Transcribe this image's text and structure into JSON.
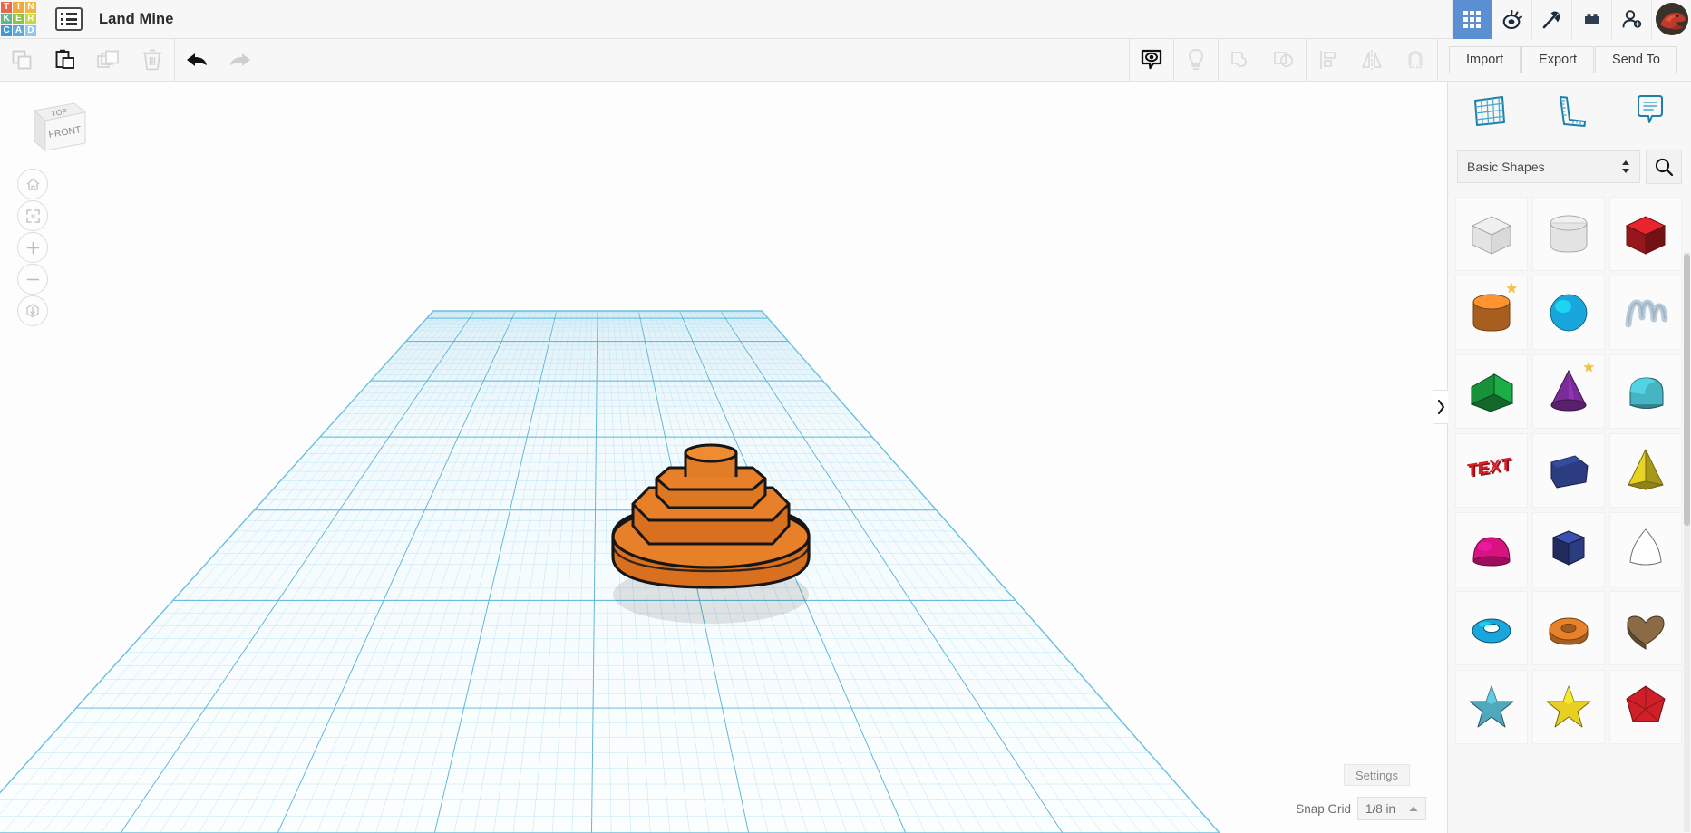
{
  "app": {
    "logo_letters": [
      {
        "ch": "T",
        "color": "#e8694a"
      },
      {
        "ch": "I",
        "color": "#f0a73c"
      },
      {
        "ch": "N",
        "color": "#f2b73d"
      },
      {
        "ch": "K",
        "color": "#5fb88d"
      },
      {
        "ch": "E",
        "color": "#8cc640"
      },
      {
        "ch": "R",
        "color": "#c3d93f"
      },
      {
        "ch": "C",
        "color": "#3f9bd6"
      },
      {
        "ch": "A",
        "color": "#5aa9e0"
      },
      {
        "ch": "D",
        "color": "#8fc8e8"
      }
    ],
    "project_title": "Land Mine",
    "doclist_icon": "list-view-icon"
  },
  "topbar_right": {
    "buttons": [
      {
        "name": "dashboard-grid-button",
        "icon": "grid-9-icon",
        "active": true
      },
      {
        "name": "codeblocks-button",
        "icon": "codeblocks-icon",
        "active": false
      },
      {
        "name": "minecraft-button",
        "icon": "pickaxe-icon",
        "active": false
      },
      {
        "name": "blocks-button",
        "icon": "lego-brick-icon",
        "active": false
      },
      {
        "name": "invite-button",
        "icon": "add-person-icon",
        "active": false
      }
    ],
    "avatar_name": "user-avatar"
  },
  "toolbar": {
    "left_tools": [
      {
        "name": "copy-button",
        "icon": "copy-icon",
        "enabled": false
      },
      {
        "name": "paste-button",
        "icon": "clipboard-paste-icon",
        "enabled": true
      },
      {
        "name": "duplicate-button",
        "icon": "duplicate-icon",
        "enabled": false
      },
      {
        "name": "delete-button",
        "icon": "trash-icon",
        "enabled": false
      }
    ],
    "history_tools": [
      {
        "name": "undo-button",
        "icon": "undo-arrow-icon",
        "enabled": true
      },
      {
        "name": "redo-button",
        "icon": "redo-arrow-icon",
        "enabled": false
      }
    ],
    "right_tools": [
      {
        "name": "show-hide-button",
        "icon": "eye-bubble-icon",
        "enabled": true
      },
      {
        "name": "light-button",
        "icon": "lightbulb-icon",
        "enabled": false
      },
      {
        "name": "group-button",
        "icon": "group-shapes-icon",
        "enabled": false
      },
      {
        "name": "ungroup-button",
        "icon": "ungroup-shapes-icon",
        "enabled": false
      },
      {
        "name": "align-button",
        "icon": "align-icon",
        "enabled": false
      },
      {
        "name": "mirror-button",
        "icon": "mirror-flip-icon",
        "enabled": false
      },
      {
        "name": "snap-magnet-button",
        "icon": "magnet-icon",
        "enabled": false
      }
    ],
    "import_label": "Import",
    "export_label": "Export",
    "sendto_label": "Send To"
  },
  "canvas": {
    "viewcube": {
      "top_label": "TOP",
      "front_label": "FRONT"
    },
    "nav_buttons": [
      {
        "name": "home-view-button",
        "icon": "home-icon"
      },
      {
        "name": "fit-view-button",
        "icon": "fit-brackets-icon"
      },
      {
        "name": "zoom-in-button",
        "icon": "plus-icon"
      },
      {
        "name": "zoom-out-button",
        "icon": "minus-icon"
      },
      {
        "name": "ortho-perspective-button",
        "icon": "cube-arrow-icon"
      }
    ],
    "model": {
      "name": "land-mine-model",
      "color": "#e8802a",
      "edge_color": "#1a1a1a"
    },
    "grid": {
      "minor_color": "#bfe3f2",
      "major_color": "#5bb3d4",
      "plane_fill": "#f4fbfe"
    }
  },
  "right_panel": {
    "tabs": [
      {
        "name": "tab-workplane",
        "icon": "workplane-grid-icon"
      },
      {
        "name": "tab-ruler",
        "icon": "ruler-icon"
      },
      {
        "name": "tab-notes",
        "icon": "note-bubble-icon"
      }
    ],
    "category_label": "Basic Shapes",
    "search_icon": "search-icon",
    "collapse_icon": "chevron-right-icon",
    "shapes": [
      {
        "name": "shape-box-hole",
        "label": "Box Hole",
        "kind": "box",
        "color": "#d8d8d8",
        "hole": true,
        "star": false
      },
      {
        "name": "shape-cylinder-hole",
        "label": "Cylinder Hole",
        "kind": "cylinder",
        "color": "#d8d8d8",
        "hole": true,
        "star": false
      },
      {
        "name": "shape-box",
        "label": "Box",
        "kind": "box",
        "color": "#cf2027",
        "hole": false,
        "star": false
      },
      {
        "name": "shape-cylinder",
        "label": "Cylinder",
        "kind": "cylinder",
        "color": "#e8822a",
        "hole": false,
        "star": true
      },
      {
        "name": "shape-sphere",
        "label": "Sphere",
        "kind": "sphere",
        "color": "#18a6dd",
        "hole": false,
        "star": false
      },
      {
        "name": "shape-scribble",
        "label": "Scribble",
        "kind": "scribble",
        "color": "#b7cbdb",
        "hole": false,
        "star": false
      },
      {
        "name": "shape-wedge",
        "label": "Wedge",
        "kind": "wedge",
        "color": "#17913a",
        "hole": false,
        "star": false
      },
      {
        "name": "shape-cone",
        "label": "Cone",
        "kind": "cone",
        "color": "#7a2d98",
        "hole": false,
        "star": true
      },
      {
        "name": "shape-roof",
        "label": "Roof",
        "kind": "roof",
        "color": "#46b4c2",
        "hole": false,
        "star": false
      },
      {
        "name": "shape-text",
        "label": "Text",
        "kind": "text",
        "color": "#d81f26",
        "hole": false,
        "star": false
      },
      {
        "name": "shape-polygon-prism",
        "label": "Polygon",
        "kind": "polyprism",
        "color": "#2c3c80",
        "hole": false,
        "star": false
      },
      {
        "name": "shape-pyramid",
        "label": "Pyramid",
        "kind": "pyramid",
        "color": "#e8d226",
        "hole": false,
        "star": false
      },
      {
        "name": "shape-half-sphere",
        "label": "Half Sphere",
        "kind": "dome",
        "color": "#d6137f",
        "hole": false,
        "star": false
      },
      {
        "name": "shape-hexagon-prism",
        "label": "Hexagon",
        "kind": "hexprism",
        "color": "#2c3c80",
        "hole": false,
        "star": false
      },
      {
        "name": "shape-paraboloid",
        "label": "Paraboloid",
        "kind": "parab",
        "color": "#e4e4e4",
        "hole": false,
        "star": false
      },
      {
        "name": "shape-torus",
        "label": "Torus",
        "kind": "torus",
        "color": "#18a6dd",
        "hole": false,
        "star": false
      },
      {
        "name": "shape-tube",
        "label": "Tube",
        "kind": "tube",
        "color": "#e8822a",
        "hole": false,
        "star": false
      },
      {
        "name": "shape-heart",
        "label": "Heart",
        "kind": "heart",
        "color": "#8a6b45",
        "hole": false,
        "star": false
      },
      {
        "name": "shape-star-thin",
        "label": "Star",
        "kind": "star",
        "color": "#4fa8bc",
        "hole": false,
        "star": false
      },
      {
        "name": "shape-star-thick",
        "label": "Star Prism",
        "kind": "star",
        "color": "#e8cf22",
        "hole": false,
        "star": false
      },
      {
        "name": "shape-polyhedron",
        "label": "Polyhedron",
        "kind": "poly",
        "color": "#cf2027",
        "hole": false,
        "star": false
      }
    ]
  },
  "footer": {
    "settings_label": "Settings",
    "snap_grid_label": "Snap Grid",
    "snap_grid_value": "1/8 in",
    "snap_caret_icon": "caret-up-icon"
  }
}
